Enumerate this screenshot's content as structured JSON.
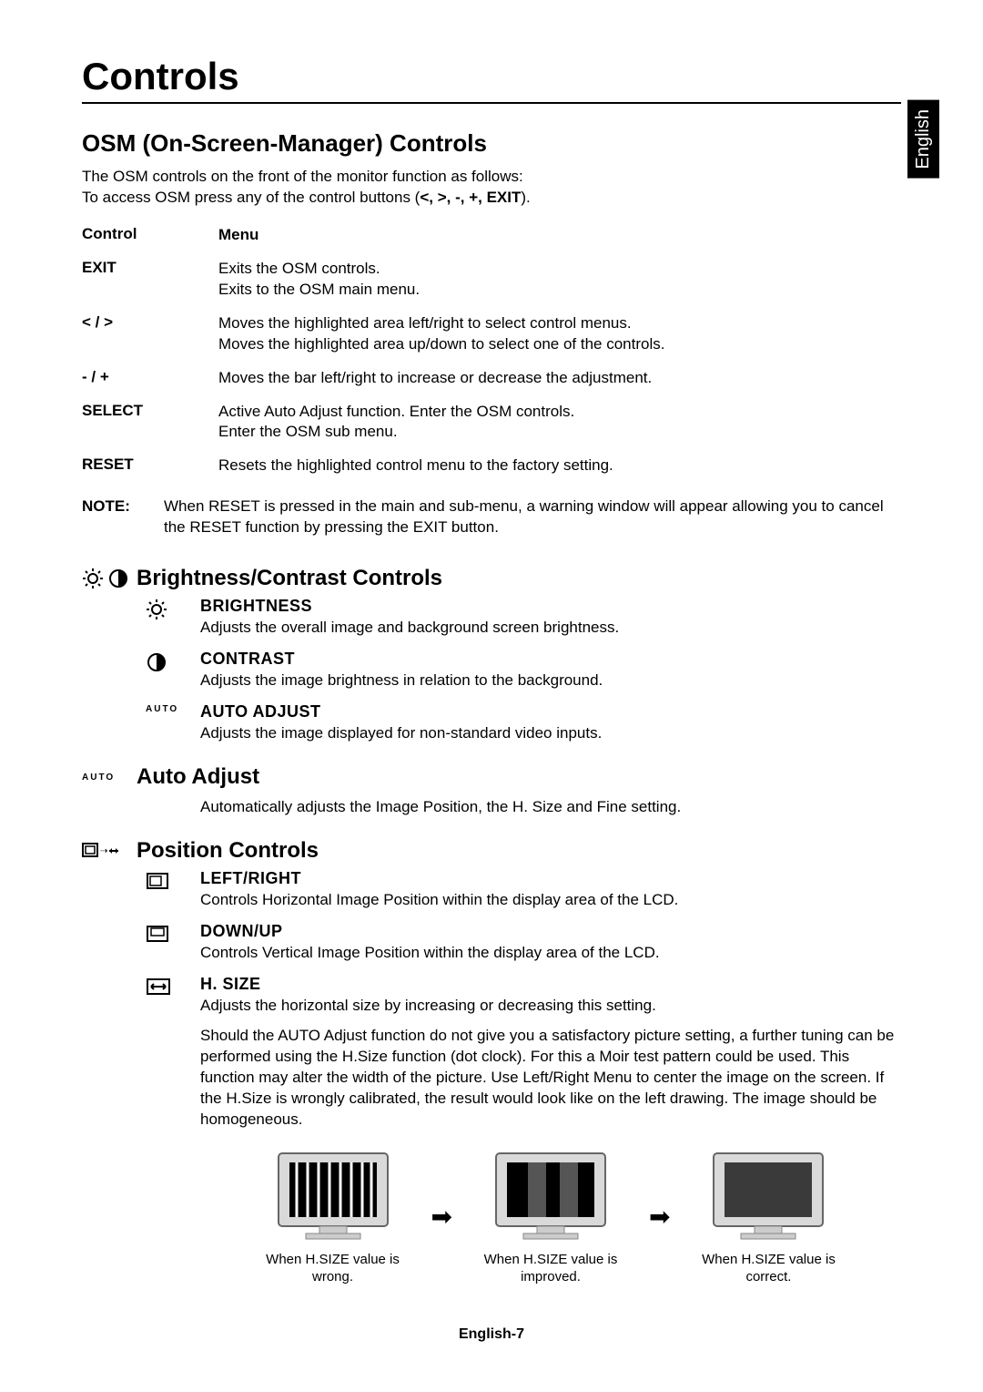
{
  "language_tab": "English",
  "page_title": "Controls",
  "osm": {
    "heading": "OSM (On-Screen-Manager) Controls",
    "intro_line1": "The OSM controls on the front of the monitor function as follows:",
    "intro_line2_prefix": "To access OSM press any of the control buttons (",
    "intro_line2_keys": "<, >, -, +, EXIT",
    "intro_line2_suffix": ").",
    "table": {
      "col0": "Control",
      "col1": "Menu",
      "rows": [
        {
          "control": "EXIT",
          "menu": "Exits the OSM controls.\nExits to the OSM main menu."
        },
        {
          "control": "< / >",
          "menu": "Moves the highlighted area left/right to select control menus.\nMoves the highlighted area up/down to select one of the controls."
        },
        {
          "control": "- / +",
          "menu": "Moves the bar left/right to increase or decrease the adjustment."
        },
        {
          "control": "SELECT",
          "menu": "Active Auto Adjust function. Enter the OSM controls.\nEnter the OSM sub menu."
        },
        {
          "control": "RESET",
          "menu": "Resets the highlighted control menu to the factory setting."
        }
      ]
    },
    "note_label": "NOTE:",
    "note_text": "When RESET is pressed in the main and sub-menu, a warning window will appear allowing you to cancel the RESET function by pressing the EXIT button."
  },
  "brightness_contrast": {
    "heading": "Brightness/Contrast Controls",
    "items": [
      {
        "icon": "brightness",
        "title": "BRIGHTNESS",
        "desc": "Adjusts the overall image and background screen brightness."
      },
      {
        "icon": "contrast",
        "title": "CONTRAST",
        "desc": "Adjusts the image brightness in relation to the background."
      },
      {
        "icon": "auto",
        "title": "AUTO ADJUST",
        "desc": "Adjusts the image displayed for non-standard video inputs."
      }
    ]
  },
  "auto_adjust": {
    "heading": "Auto Adjust",
    "desc": "Automatically adjusts the Image Position, the H. Size and Fine setting."
  },
  "position": {
    "heading": "Position Controls",
    "items": [
      {
        "icon": "leftright",
        "title": "LEFT/RIGHT",
        "desc": "Controls Horizontal Image Position within the display area of the LCD."
      },
      {
        "icon": "downup",
        "title": "DOWN/UP",
        "desc": "Controls Vertical Image Position within the display area of the LCD."
      },
      {
        "icon": "hsize",
        "title": "H. SIZE",
        "desc": "Adjusts the horizontal size by increasing or decreasing this setting.",
        "para": "Should the  AUTO Adjust function  do not give you a satisfactory picture setting, a further tuning can be performed using the  H.Size  function (dot clock). For this a Moir   test pattern could be used. This function may alter the width of the picture. Use Left/Right Menu to center the image on the screen. If the H.Size is wrongly calibrated, the result would look like on the left drawing. The image should be homogeneous."
      }
    ],
    "diagram": {
      "captions": [
        "When H.SIZE value is wrong.",
        "When H.SIZE value is improved.",
        "When H.SIZE value is correct."
      ]
    }
  },
  "footer": "English-7",
  "auto_icon_label": "AUTO"
}
